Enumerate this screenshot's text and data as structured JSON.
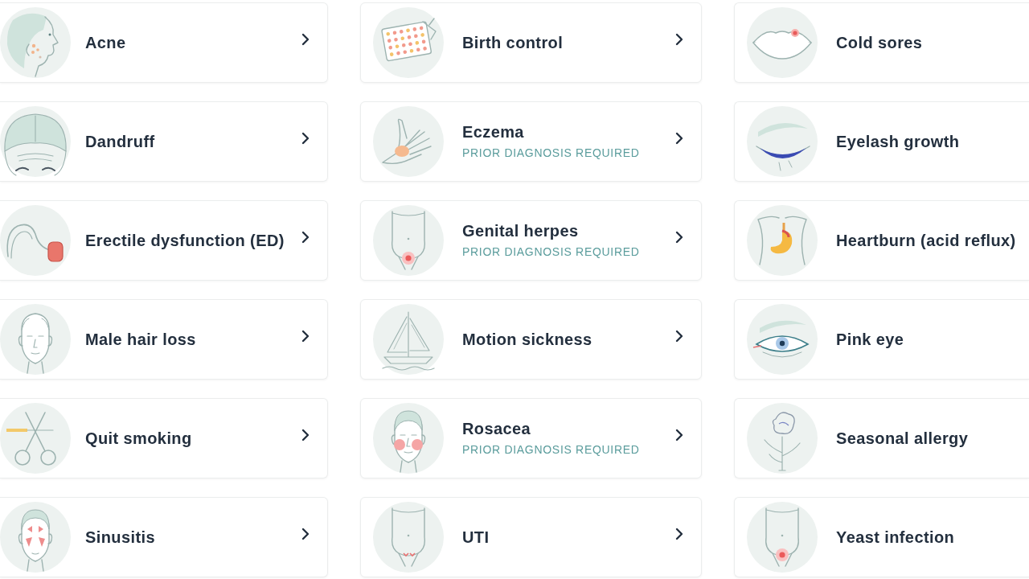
{
  "conditions": [
    {
      "title": "Acne",
      "kind": "profile"
    },
    {
      "title": "Birth control",
      "kind": "pills"
    },
    {
      "title": "Cold sores",
      "kind": "lips"
    },
    {
      "title": "Dandruff",
      "kind": "scalp"
    },
    {
      "title": "Eczema",
      "note": "PRIOR DIAGNOSIS REQUIRED",
      "kind": "hand"
    },
    {
      "title": "Eyelash growth",
      "kind": "eyelash"
    },
    {
      "title": "Erectile dysfunction (ED)",
      "kind": "capsule"
    },
    {
      "title": "Genital herpes",
      "note": "PRIOR DIAGNOSIS REQUIRED",
      "kind": "pelvis"
    },
    {
      "title": "Heartburn (acid reflux)",
      "kind": "stomach"
    },
    {
      "title": "Male hair loss",
      "kind": "face"
    },
    {
      "title": "Motion sickness",
      "kind": "boat"
    },
    {
      "title": "Pink eye",
      "kind": "eye"
    },
    {
      "title": "Quit smoking",
      "kind": "scissors"
    },
    {
      "title": "Rosacea",
      "note": "PRIOR DIAGNOSIS REQUIRED",
      "kind": "cheeks"
    },
    {
      "title": "Seasonal allergy",
      "kind": "flower"
    },
    {
      "title": "Sinusitis",
      "kind": "sinus"
    },
    {
      "title": "UTI",
      "kind": "bladder"
    },
    {
      "title": "Yeast infection",
      "kind": "pelvis"
    }
  ]
}
